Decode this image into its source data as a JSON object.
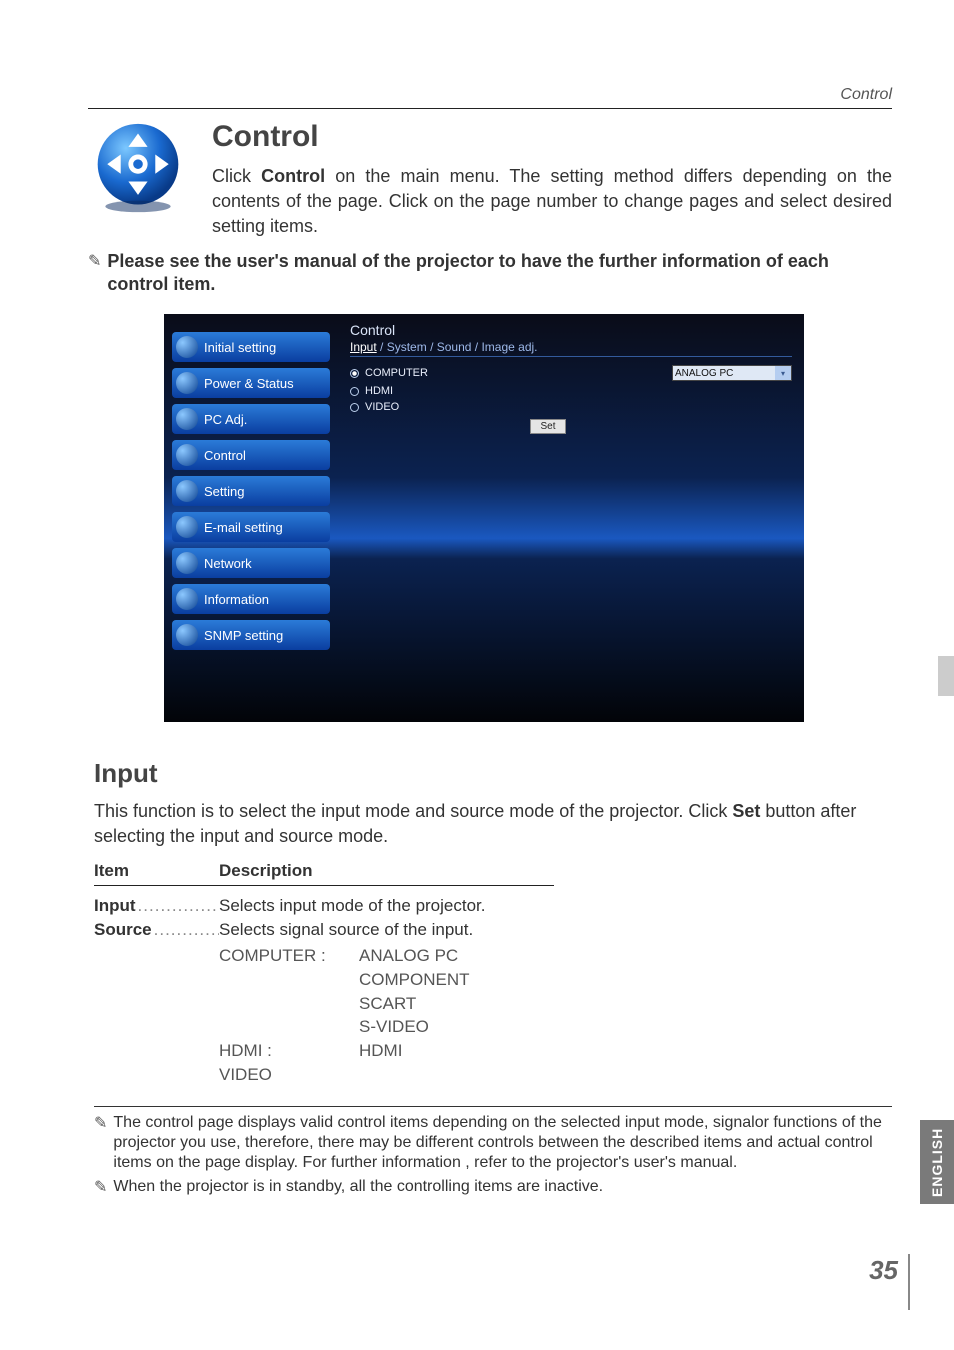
{
  "header": {
    "section_label": "Control"
  },
  "intro": {
    "title": "Control",
    "paragraph_pre": "Click ",
    "paragraph_bold": "Control",
    "paragraph_post": " on the main menu. The setting method differs depending on the contents of the page. Click on the page number to change pages and select desired setting items."
  },
  "note_main": "Please see the user's manual of the projector to have the further information of each control item.",
  "screenshot": {
    "sidebar_items": [
      "Initial setting",
      "Power & Status",
      "PC Adj.",
      "Control",
      "Setting",
      "E-mail setting",
      "Network",
      "Information",
      "SNMP setting"
    ],
    "panel_title": "Control",
    "tabs": [
      "Input",
      "System",
      "Sound",
      "Image adj."
    ],
    "radios": [
      {
        "label": "COMPUTER",
        "checked": true
      },
      {
        "label": "HDMI",
        "checked": false
      },
      {
        "label": "VIDEO",
        "checked": false
      }
    ],
    "dropdown_value": "ANALOG PC",
    "set_button": "Set"
  },
  "input_section": {
    "title": "Input",
    "desc_pre": "This function is to select the input mode and source mode of the projector.  Click ",
    "desc_bold": "Set",
    "desc_post": " button after selecting the input and source mode.",
    "table": {
      "headers": {
        "item": "Item",
        "desc": "Description"
      },
      "row_input": {
        "name": "Input",
        "desc": "Selects input mode of the projector."
      },
      "row_source": {
        "name": "Source",
        "desc": "Selects signal source of the input.",
        "options": [
          {
            "col1": "COMPUTER :",
            "col2": "ANALOG PC"
          },
          {
            "col1": "",
            "col2": "COMPONENT"
          },
          {
            "col1": "",
            "col2": "SCART"
          },
          {
            "col1": "",
            "col2": "S-VIDEO"
          },
          {
            "col1": "HDMI :",
            "col2": "HDMI"
          },
          {
            "col1": "VIDEO",
            "col2": ""
          }
        ]
      }
    }
  },
  "footer_notes": [
    "The control page displays valid control items depending on the selected input mode, signalor functions of the projector you use, therefore, there may be different controls between the described items and actual control items on the page display. For further information , refer to the projector's user's manual.",
    "When the projector is in standby, all the controlling items are inactive."
  ],
  "side_tab": "ENGLISH",
  "page_number": "35"
}
